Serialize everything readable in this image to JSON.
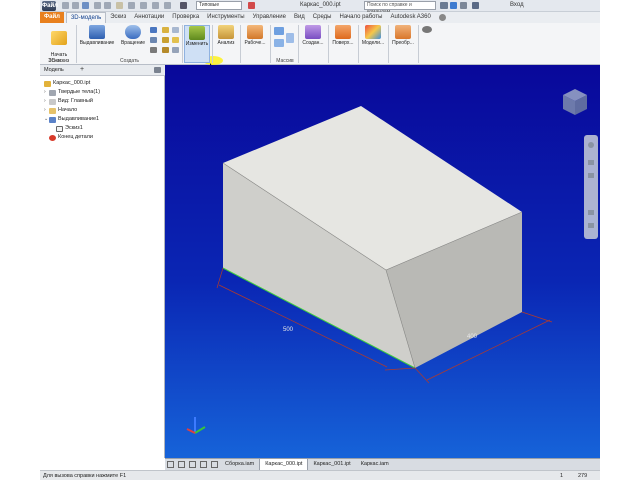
{
  "quickbar": {
    "app_button": "Файл",
    "style": "Типовые",
    "title": "Каркас_000.ipt",
    "search_placeholder": "Поиск по справке и командам",
    "login": "Вход"
  },
  "menu": {
    "tabs": [
      {
        "label": "Файл"
      },
      {
        "label": "3D-модель"
      },
      {
        "label": "Эскиз"
      },
      {
        "label": "Аннотации"
      },
      {
        "label": "Проверка"
      },
      {
        "label": "Инструменты"
      },
      {
        "label": "Управление"
      },
      {
        "label": "Вид"
      },
      {
        "label": "Среды"
      },
      {
        "label": "Начало работы"
      },
      {
        "label": "Autodesk A360"
      }
    ],
    "active_index": 1
  },
  "ribbon": {
    "start_sketch": "Начать\n2D-эскиз",
    "sketch_group": "Эскиз",
    "extrude": "Выдавливание",
    "revolve": "Вращение",
    "create_group": "Создать",
    "modify": "Изменить",
    "analysis": "Анализ",
    "workplanes": "Рабоче...",
    "pattern_group": "Массив",
    "create2": "Создан...",
    "surface": "Поверх...",
    "simulation": "Модели...",
    "convert": "Преобр..."
  },
  "browser": {
    "tab": "Модель",
    "items": [
      {
        "label": "Каркас_000.ipt",
        "level": 0
      },
      {
        "label": "Твердые тела(1)",
        "level": 1
      },
      {
        "label": "Вид: Главный",
        "level": 1
      },
      {
        "label": "Начало",
        "level": 1
      },
      {
        "label": "Выдавливание1",
        "level": 1
      },
      {
        "label": "Эскиз1",
        "level": 2
      },
      {
        "label": "Конец детали",
        "level": 1
      }
    ]
  },
  "viewport": {
    "dim_length": "500",
    "dim_width": "400"
  },
  "doctabs": {
    "items": [
      {
        "label": "Сборка.iam",
        "active": false
      },
      {
        "label": "Каркас_000.ipt",
        "active": true
      },
      {
        "label": "Каркас_001.ipt",
        "active": false
      },
      {
        "label": "Каркас.iam",
        "active": false
      }
    ]
  },
  "status": {
    "help": "Для вызова справки нажмите F1",
    "count1": "1",
    "count2": "279"
  },
  "colors": {
    "viewport_top": "#09089a",
    "viewport_bottom": "#1663d9",
    "file_tab": "#e8801e",
    "box_top": "#e6e6e2",
    "box_left": "#cfcfcb",
    "box_right": "#b9b9b5"
  }
}
